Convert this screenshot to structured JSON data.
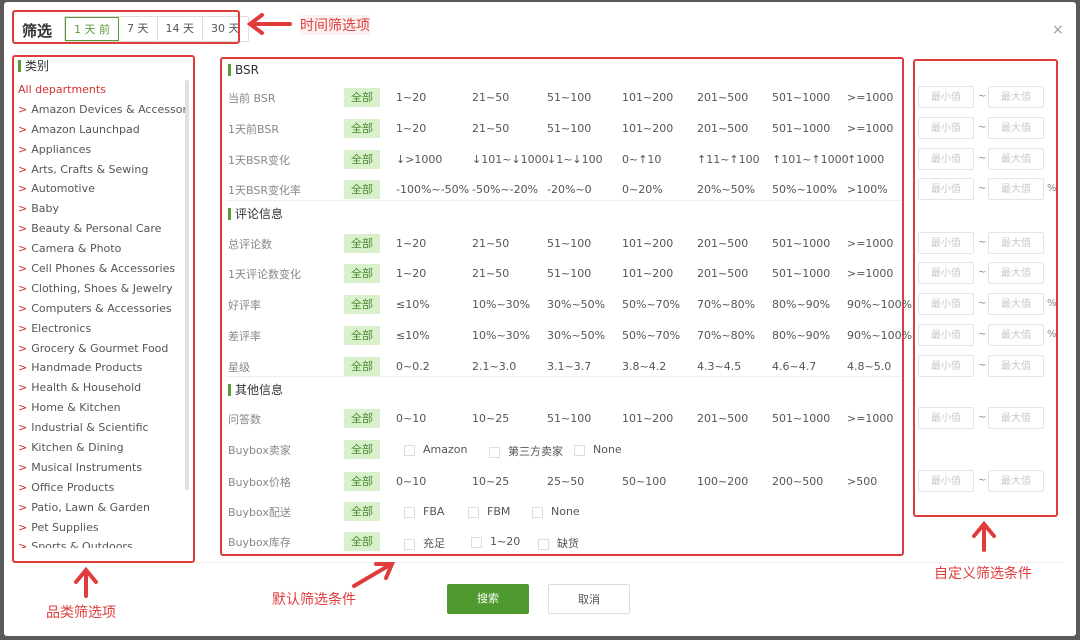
{
  "header": {
    "title": "筛选",
    "tabs": [
      "1 天 前",
      "7 天",
      "14 天",
      "30 天"
    ],
    "active_tab": 0,
    "close": "×"
  },
  "categories": {
    "title": "类别",
    "items": [
      "All departments",
      "Amazon Devices & Accessories",
      "Amazon Launchpad",
      "Appliances",
      "Arts, Crafts & Sewing",
      "Automotive",
      "Baby",
      "Beauty & Personal Care",
      "Camera & Photo",
      "Cell Phones & Accessories",
      "Clothing, Shoes & Jewelry",
      "Computers & Accessories",
      "Electronics",
      "Grocery & Gourmet Food",
      "Handmade Products",
      "Health & Household",
      "Home & Kitchen",
      "Industrial & Scientific",
      "Kitchen & Dining",
      "Musical Instruments",
      "Office Products",
      "Patio, Lawn & Garden",
      "Pet Supplies",
      "Sports & Outdoors"
    ]
  },
  "all_label": "全部",
  "custom": {
    "min": "最小值",
    "max": "最大值",
    "sep": "~",
    "pct": "%"
  },
  "sections": [
    {
      "title": "BSR",
      "rows": [
        {
          "label": "当前 BSR",
          "options": [
            "1~20",
            "21~50",
            "51~100",
            "101~200",
            "201~500",
            "501~1000",
            ">=1000"
          ],
          "custom": true
        },
        {
          "label": "1天前BSR",
          "options": [
            "1~20",
            "21~50",
            "51~100",
            "101~200",
            "201~500",
            "501~1000",
            ">=1000"
          ],
          "custom": true
        },
        {
          "label": "1天BSR变化",
          "options": [
            "↓>1000",
            "↓101~↓1000",
            "↓1~↓100",
            "0~↑10",
            "↑11~↑100",
            "↑101~↑1000",
            "↑1000"
          ],
          "custom": true
        },
        {
          "label": "1天BSR变化率",
          "options": [
            "-100%~-50%",
            "-50%~-20%",
            "-20%~0",
            "0~20%",
            "20%~50%",
            "50%~100%",
            ">100%"
          ],
          "custom": true,
          "pct": true
        }
      ]
    },
    {
      "title": "评论信息",
      "rows": [
        {
          "label": "总评论数",
          "options": [
            "1~20",
            "21~50",
            "51~100",
            "101~200",
            "201~500",
            "501~1000",
            ">=1000"
          ],
          "custom": true
        },
        {
          "label": "1天评论数变化",
          "options": [
            "1~20",
            "21~50",
            "51~100",
            "101~200",
            "201~500",
            "501~1000",
            ">=1000"
          ],
          "custom": true
        },
        {
          "label": "好评率",
          "options": [
            "≤10%",
            "10%~30%",
            "30%~50%",
            "50%~70%",
            "70%~80%",
            "80%~90%",
            "90%~100%"
          ],
          "custom": true,
          "pct": true
        },
        {
          "label": "差评率",
          "options": [
            "≤10%",
            "10%~30%",
            "30%~50%",
            "50%~70%",
            "70%~80%",
            "80%~90%",
            "90%~100%"
          ],
          "custom": true,
          "pct": true
        },
        {
          "label": "星级",
          "options": [
            "0~0.2",
            "2.1~3.0",
            "3.1~3.7",
            "3.8~4.2",
            "4.3~4.5",
            "4.6~4.7",
            "4.8~5.0"
          ],
          "custom": true
        }
      ]
    },
    {
      "title": "其他信息",
      "rows": [
        {
          "label": "问答数",
          "options": [
            "0~10",
            "10~25",
            "51~100",
            "101~200",
            "201~500",
            "501~1000",
            ">=1000"
          ],
          "custom": true
        },
        {
          "label": "Buybox卖家",
          "checkboxes": [
            "Amazon",
            "第三方卖家",
            "None"
          ],
          "cbgap": 85
        },
        {
          "label": "Buybox价格",
          "options": [
            "0~10",
            "10~25",
            "25~50",
            "50~100",
            "100~200",
            "200~500",
            ">500"
          ],
          "custom": true
        },
        {
          "label": "Buybox配送",
          "checkboxes": [
            "FBA",
            "FBM",
            "None"
          ],
          "cbgap": 64
        },
        {
          "label": "Buybox库存",
          "checkboxes": [
            "充足",
            "1~20",
            "缺货"
          ],
          "cbgap": 67
        }
      ]
    }
  ],
  "footer": {
    "search": "搜索",
    "cancel": "取消"
  },
  "annotations": {
    "time": "时间筛选项",
    "category": "品类筛选项",
    "default": "默认筛选条件",
    "custom": "自定义筛选条件"
  },
  "colors": {
    "accent": "#5a9a3a",
    "annotation": "#e03c3c",
    "category_red": "#d03030"
  }
}
